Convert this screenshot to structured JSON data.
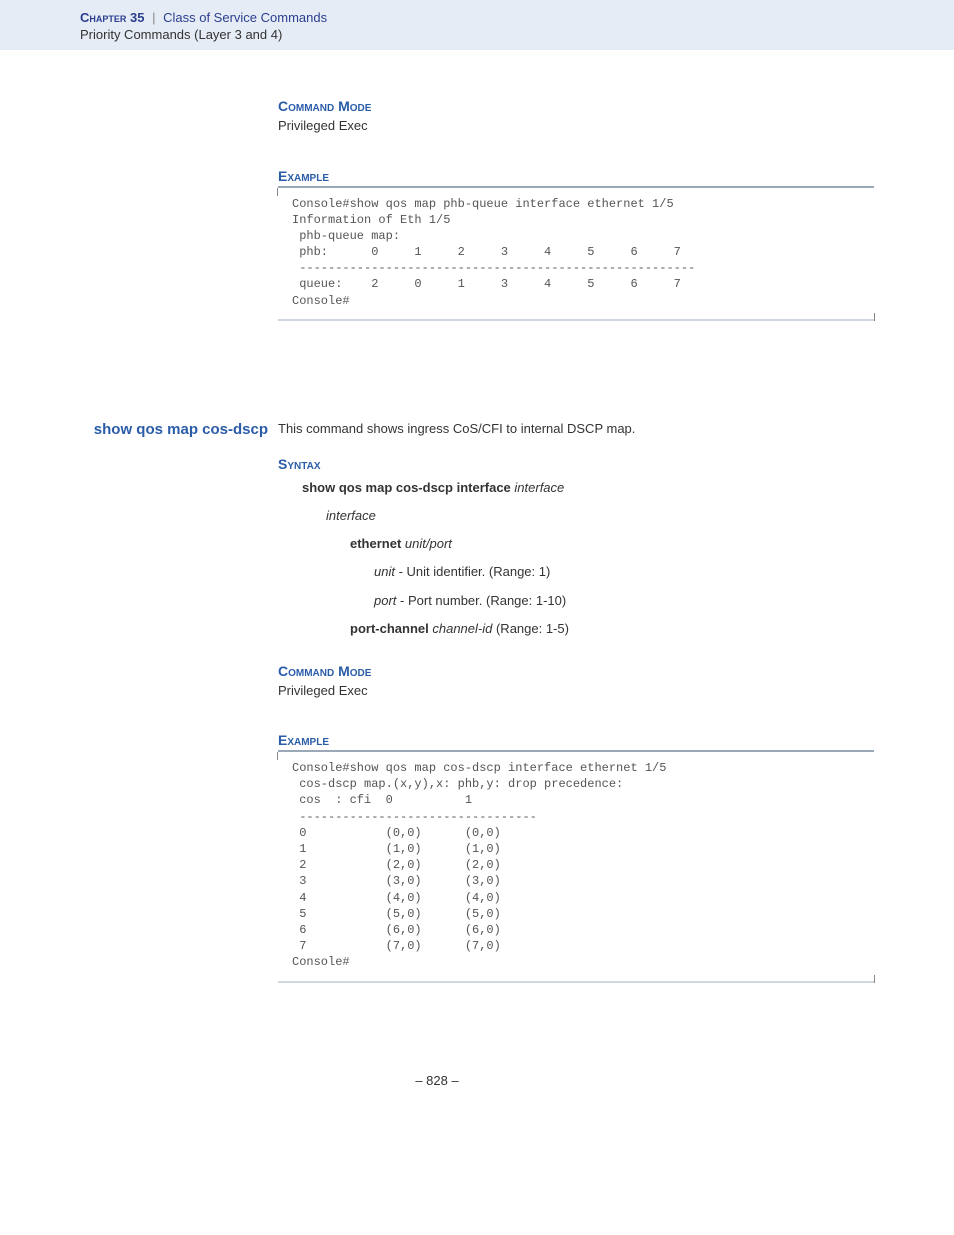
{
  "header": {
    "chapter_label": "Chapter 35",
    "divider": "|",
    "section_title": "Class of Service Commands",
    "subsection": "Priority Commands (Layer 3 and 4)"
  },
  "block1": {
    "cmd_mode_label": "Command Mode",
    "cmd_mode_text": "Privileged Exec",
    "example_label": "Example",
    "code": "Console#show qos map phb-queue interface ethernet 1/5\nInformation of Eth 1/5\n phb-queue map:\n phb:      0     1     2     3     4     5     6     7\n -------------------------------------------------------\n queue:    2     0     1     3     4     5     6     7\nConsole#"
  },
  "block2": {
    "cmd_title": "show qos map cos-dscp",
    "intro": "This command shows ingress CoS/CFI to internal DSCP map.",
    "syntax_label": "Syntax",
    "syntax_cmd_bold": "show qos map cos-dscp interface",
    "syntax_cmd_italic": "interface",
    "param_interface": "interface",
    "ethernet_bold": "ethernet",
    "ethernet_args": "unit/port",
    "unit_label": "unit",
    "unit_desc": " - Unit identifier. (Range: 1)",
    "port_label": "port",
    "port_desc": " - Port number. (Range: 1-10)",
    "portchannel_bold": "port-channel",
    "portchannel_arg": "channel-id",
    "portchannel_range": " (Range: 1-5)",
    "cmd_mode_label": "Command Mode",
    "cmd_mode_text": "Privileged Exec",
    "example_label": "Example",
    "code": "Console#show qos map cos-dscp interface ethernet 1/5\n cos-dscp map.(x,y),x: phb,y: drop precedence:\n cos  : cfi  0          1\n ---------------------------------\n 0           (0,0)      (0,0)\n 1           (1,0)      (1,0)\n 2           (2,0)      (2,0)\n 3           (3,0)      (3,0)\n 4           (4,0)      (4,0)\n 5           (5,0)      (5,0)\n 6           (6,0)      (6,0)\n 7           (7,0)      (7,0)\nConsole#"
  },
  "page_number": "– 828 –",
  "chart_data": [
    {
      "type": "table",
      "title": "phb-queue map (Eth 1/5)",
      "columns": [
        "phb",
        0,
        1,
        2,
        3,
        4,
        5,
        6,
        7
      ],
      "rows": [
        {
          "label": "queue",
          "values": [
            2,
            0,
            1,
            3,
            4,
            5,
            6,
            7
          ]
        }
      ]
    },
    {
      "type": "table",
      "title": "cos-dscp map (Eth 1/5) — (phb, drop precedence)",
      "columns": [
        "cos",
        "cfi 0",
        "cfi 1"
      ],
      "rows": [
        {
          "cos": 0,
          "cfi0": "(0,0)",
          "cfi1": "(0,0)"
        },
        {
          "cos": 1,
          "cfi0": "(1,0)",
          "cfi1": "(1,0)"
        },
        {
          "cos": 2,
          "cfi0": "(2,0)",
          "cfi1": "(2,0)"
        },
        {
          "cos": 3,
          "cfi0": "(3,0)",
          "cfi1": "(3,0)"
        },
        {
          "cos": 4,
          "cfi0": "(4,0)",
          "cfi1": "(4,0)"
        },
        {
          "cos": 5,
          "cfi0": "(5,0)",
          "cfi1": "(5,0)"
        },
        {
          "cos": 6,
          "cfi0": "(6,0)",
          "cfi1": "(6,0)"
        },
        {
          "cos": 7,
          "cfi0": "(7,0)",
          "cfi1": "(7,0)"
        }
      ]
    }
  ]
}
